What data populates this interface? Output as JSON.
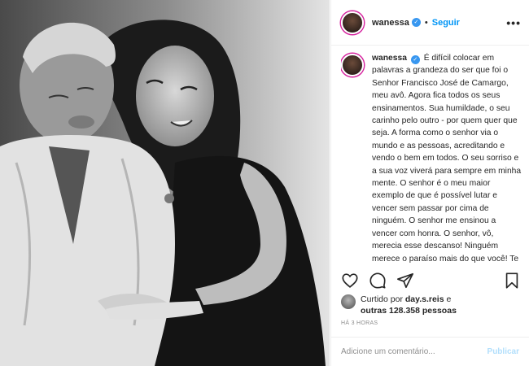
{
  "post": {
    "username": "wanessa",
    "follow_label": "Seguir",
    "separator": "•",
    "more_label": "•••",
    "verified_mark": "✓"
  },
  "caption": {
    "username": "wanessa",
    "text": "É difícil colocar em palavras a grandeza do ser que foi o Senhor Francisco José de Camargo, meu avô. Agora fica todos os seus ensinamentos. Sua humildade, o seu carinho pelo outro - por quem quer que seja. A forma como o senhor via o mundo e as pessoas, acreditando e vendo o bem em todos. O seu sorriso e a sua voz viverá para sempre em minha mente. O senhor é o meu maior exemplo de que é possível lutar e vencer sem passar por cima de ninguém. O senhor me ensinou a vencer com honra. O senhor, vô, merecia esse descanso! Ninguém merece o paraíso mais do que você! Te amo pra sempre!"
  },
  "actions": {
    "icons": [
      "heart-icon",
      "comment-icon",
      "share-icon",
      "bookmark-icon"
    ]
  },
  "likes": {
    "prefix": "Curtido por",
    "user": "day.s.reis",
    "middle": "e",
    "others": "outras 128.358 pessoas"
  },
  "timestamp": "HÁ 3 HORAS",
  "comment": {
    "placeholder": "Adicione um comentário...",
    "publish_label": "Publicar"
  },
  "colors": {
    "accent": "#0095f6",
    "publish_disabled": "#b2dffc",
    "verified": "#3897f0",
    "muted": "#8e8e8e"
  }
}
